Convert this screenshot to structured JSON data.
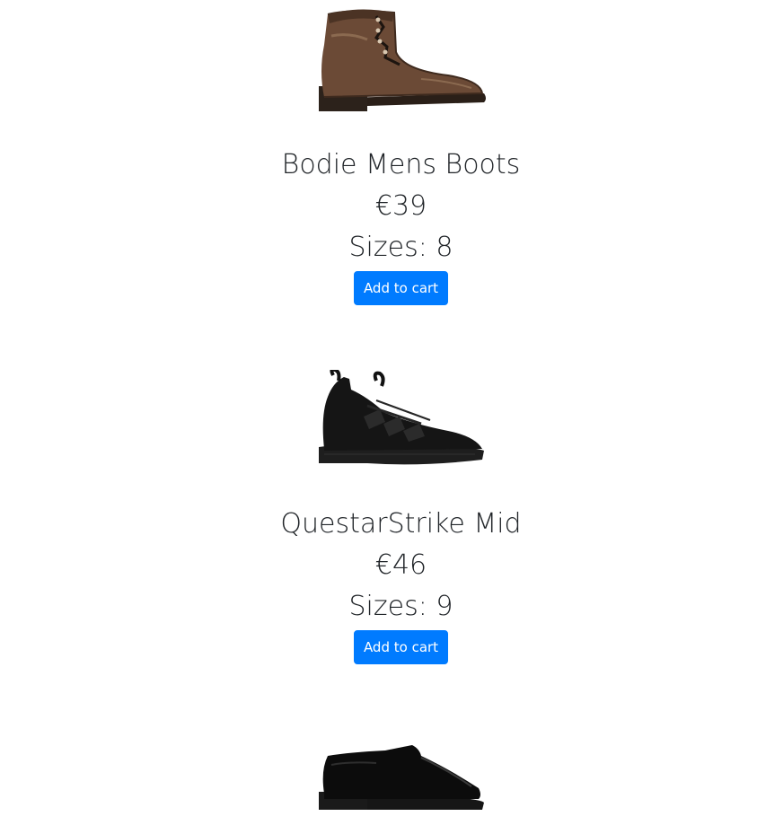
{
  "products": [
    {
      "name": "Bodie Mens Boots",
      "price": "€39",
      "sizes": "Sizes: 8",
      "button_label": "Add to cart"
    },
    {
      "name": "QuestarStrike Mid",
      "price": "€46",
      "sizes": "Sizes: 9",
      "button_label": "Add to cart"
    },
    {
      "name": "",
      "price": "",
      "sizes": "",
      "button_label": ""
    }
  ],
  "colors": {
    "button": "#007bff",
    "text": "#212529"
  }
}
